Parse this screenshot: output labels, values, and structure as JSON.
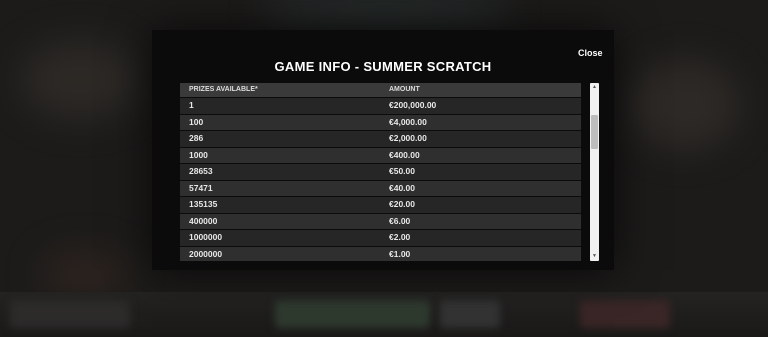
{
  "modal": {
    "title": "GAME INFO - SUMMER SCRATCH",
    "close_label": "Close"
  },
  "table": {
    "columns": [
      "PRIZES AVAILABLE*",
      "AMOUNT"
    ],
    "rows": [
      {
        "prizes": "1",
        "amount": "€200,000.00"
      },
      {
        "prizes": "100",
        "amount": "€4,000.00"
      },
      {
        "prizes": "286",
        "amount": "€2,000.00"
      },
      {
        "prizes": "1000",
        "amount": "€400.00"
      },
      {
        "prizes": "28653",
        "amount": "€50.00"
      },
      {
        "prizes": "57471",
        "amount": "€40.00"
      },
      {
        "prizes": "135135",
        "amount": "€20.00"
      },
      {
        "prizes": "400000",
        "amount": "€6.00"
      },
      {
        "prizes": "1000000",
        "amount": "€2.00"
      },
      {
        "prizes": "2000000",
        "amount": "€1.00"
      }
    ]
  },
  "scrollbar": {
    "up_icon": "triangle-up-icon",
    "down_icon": "triangle-down-icon"
  }
}
